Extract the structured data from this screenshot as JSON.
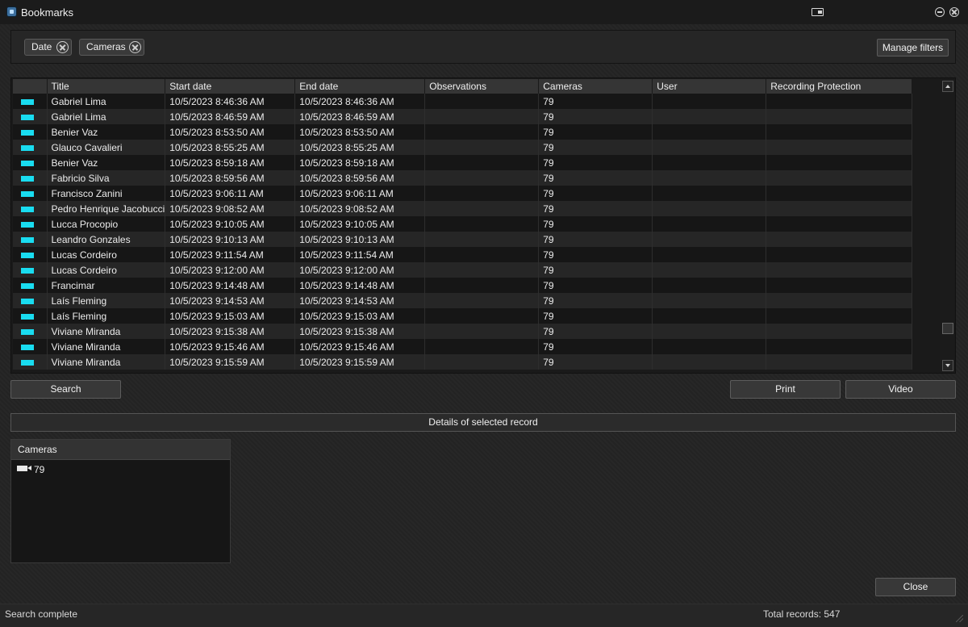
{
  "window": {
    "title": "Bookmarks"
  },
  "filters": {
    "chips": [
      {
        "label": "Date"
      },
      {
        "label": "Cameras"
      }
    ],
    "manage_label": "Manage filters"
  },
  "grid": {
    "columns": [
      "",
      "Title",
      "Start date",
      "End date",
      "Observations",
      "Cameras",
      "User",
      "Recording Protection"
    ],
    "rows": [
      {
        "title": "Gabriel Lima",
        "start": "10/5/2023 8:46:36 AM",
        "end": "10/5/2023 8:46:36 AM",
        "observations": "",
        "cameras": "79",
        "user": "",
        "protection": ""
      },
      {
        "title": "Gabriel Lima",
        "start": "10/5/2023 8:46:59 AM",
        "end": "10/5/2023 8:46:59 AM",
        "observations": "",
        "cameras": "79",
        "user": "",
        "protection": ""
      },
      {
        "title": "Benier Vaz",
        "start": "10/5/2023 8:53:50 AM",
        "end": "10/5/2023 8:53:50 AM",
        "observations": "",
        "cameras": "79",
        "user": "",
        "protection": ""
      },
      {
        "title": "Glauco Cavalieri",
        "start": "10/5/2023 8:55:25 AM",
        "end": "10/5/2023 8:55:25 AM",
        "observations": "",
        "cameras": "79",
        "user": "",
        "protection": ""
      },
      {
        "title": "Benier Vaz",
        "start": "10/5/2023 8:59:18 AM",
        "end": "10/5/2023 8:59:18 AM",
        "observations": "",
        "cameras": "79",
        "user": "",
        "protection": ""
      },
      {
        "title": "Fabricio Silva",
        "start": "10/5/2023 8:59:56 AM",
        "end": "10/5/2023 8:59:56 AM",
        "observations": "",
        "cameras": "79",
        "user": "",
        "protection": ""
      },
      {
        "title": "Francisco Zanini",
        "start": "10/5/2023 9:06:11 AM",
        "end": "10/5/2023 9:06:11 AM",
        "observations": "",
        "cameras": "79",
        "user": "",
        "protection": ""
      },
      {
        "title": "Pedro Henrique Jacobucci",
        "start": "10/5/2023 9:08:52 AM",
        "end": "10/5/2023 9:08:52 AM",
        "observations": "",
        "cameras": "79",
        "user": "",
        "protection": ""
      },
      {
        "title": "Lucca Procopio",
        "start": "10/5/2023 9:10:05 AM",
        "end": "10/5/2023 9:10:05 AM",
        "observations": "",
        "cameras": "79",
        "user": "",
        "protection": ""
      },
      {
        "title": "Leandro Gonzales",
        "start": "10/5/2023 9:10:13 AM",
        "end": "10/5/2023 9:10:13 AM",
        "observations": "",
        "cameras": "79",
        "user": "",
        "protection": ""
      },
      {
        "title": "Lucas Cordeiro",
        "start": "10/5/2023 9:11:54 AM",
        "end": "10/5/2023 9:11:54 AM",
        "observations": "",
        "cameras": "79",
        "user": "",
        "protection": ""
      },
      {
        "title": "Lucas Cordeiro",
        "start": "10/5/2023 9:12:00 AM",
        "end": "10/5/2023 9:12:00 AM",
        "observations": "",
        "cameras": "79",
        "user": "",
        "protection": ""
      },
      {
        "title": "Francimar",
        "start": "10/5/2023 9:14:48 AM",
        "end": "10/5/2023 9:14:48 AM",
        "observations": "",
        "cameras": "79",
        "user": "",
        "protection": ""
      },
      {
        "title": "Laís Fleming",
        "start": "10/5/2023 9:14:53 AM",
        "end": "10/5/2023 9:14:53 AM",
        "observations": "",
        "cameras": "79",
        "user": "",
        "protection": ""
      },
      {
        "title": "Laís Fleming",
        "start": "10/5/2023 9:15:03 AM",
        "end": "10/5/2023 9:15:03 AM",
        "observations": "",
        "cameras": "79",
        "user": "",
        "protection": ""
      },
      {
        "title": "Viviane Miranda",
        "start": "10/5/2023 9:15:38 AM",
        "end": "10/5/2023 9:15:38 AM",
        "observations": "",
        "cameras": "79",
        "user": "",
        "protection": ""
      },
      {
        "title": "Viviane Miranda",
        "start": "10/5/2023 9:15:46 AM",
        "end": "10/5/2023 9:15:46 AM",
        "observations": "",
        "cameras": "79",
        "user": "",
        "protection": ""
      },
      {
        "title": "Viviane Miranda",
        "start": "10/5/2023 9:15:59 AM",
        "end": "10/5/2023 9:15:59 AM",
        "observations": "",
        "cameras": "79",
        "user": "",
        "protection": ""
      }
    ],
    "row_marker_color": "#19dcf0"
  },
  "actions": {
    "search_label": "Search",
    "print_label": "Print",
    "video_label": "Video",
    "close_label": "Close"
  },
  "details": {
    "title": "Details of selected record",
    "cameras_header": "Cameras",
    "cameras": [
      {
        "name": "79",
        "icon": "video-camera-icon"
      }
    ]
  },
  "status": {
    "text": "Search complete",
    "total": "Total records: 547"
  }
}
